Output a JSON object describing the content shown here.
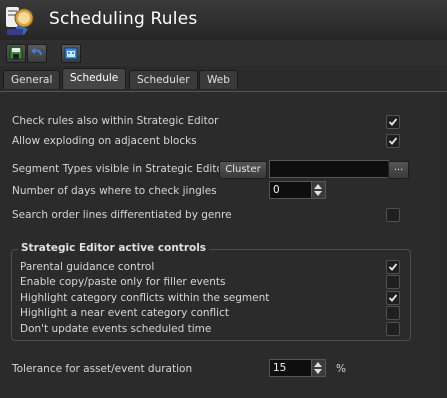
{
  "window": {
    "title": "Scheduling Rules"
  },
  "toolbar": {
    "buttons": [
      {
        "name": "save-icon"
      },
      {
        "name": "undo-icon"
      },
      {
        "name": "calendar-icon"
      }
    ]
  },
  "tabs": [
    {
      "label": "General",
      "active": false
    },
    {
      "label": "Schedule",
      "active": true
    },
    {
      "label": "Scheduler",
      "active": false
    },
    {
      "label": "Web",
      "active": false
    }
  ],
  "options": {
    "check_rules_strategic": {
      "label": "Check rules also within Strategic Editor",
      "checked": true
    },
    "allow_exploding": {
      "label": "Allow exploding on adjacent blocks",
      "checked": true
    },
    "segment_types": {
      "label": "Segment Types visible in Strategic Editor",
      "button": "Cluster",
      "value": "",
      "browse": "..."
    },
    "days_jingles": {
      "label": "Number of days where to check jingles",
      "value": "0"
    },
    "search_genre": {
      "label": "Search order lines differentiated by genre",
      "checked": false
    }
  },
  "strategic_group": {
    "title": "Strategic Editor active controls",
    "items": [
      {
        "label": "Parental guidance control",
        "checked": true
      },
      {
        "label": "Enable copy/paste only for filler events",
        "checked": false
      },
      {
        "label": "Highlight category conflicts within the segment",
        "checked": true
      },
      {
        "label": "Highlight a near event category conflict",
        "checked": false
      },
      {
        "label": "Don't update events scheduled time",
        "checked": false
      }
    ]
  },
  "tolerance": {
    "label": "Tolerance for asset/event duration",
    "value": "15",
    "unit": "%"
  }
}
